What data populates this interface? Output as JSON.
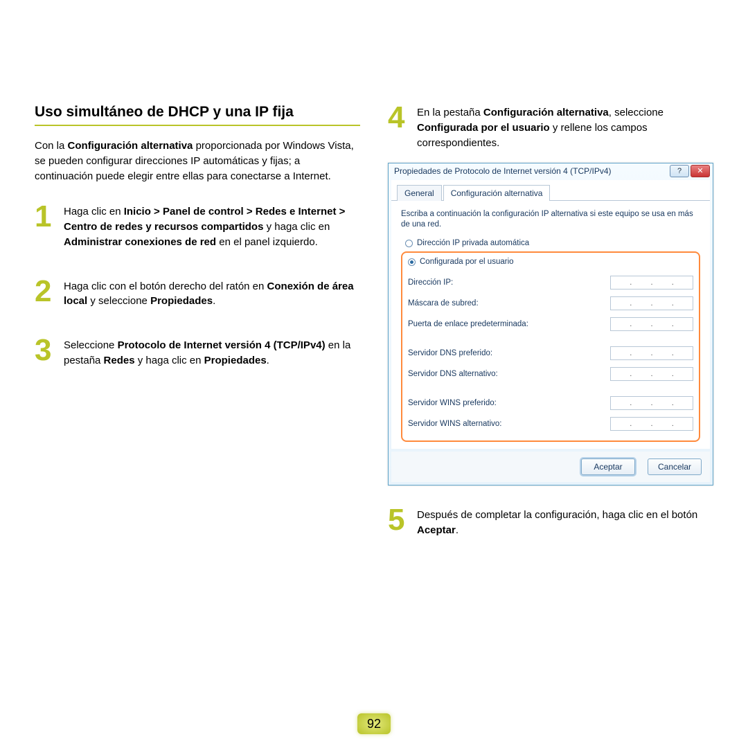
{
  "page_number": "92",
  "heading": "Uso simultáneo de DHCP y una IP fija",
  "intro": {
    "pre": "Con la ",
    "b1": "Configuración alternativa",
    "post": " proporcionada por Windows Vista, se pueden configurar direcciones IP automáticas y fijas; a continuación puede elegir entre ellas para conectarse a Internet."
  },
  "steps": {
    "s1": {
      "num": "1",
      "t1": "Haga clic en ",
      "b1": "Inicio > Panel de control > Redes e Internet > Centro de redes y recursos compartidos",
      "t2": " y haga clic en ",
      "b2": "Administrar conexiones de red",
      "t3": " en el panel izquierdo."
    },
    "s2": {
      "num": "2",
      "t1": "Haga clic con el botón derecho del ratón en ",
      "b1": "Conexión de área local",
      "t2": " y seleccione ",
      "b2": "Propiedades",
      "t3": "."
    },
    "s3": {
      "num": "3",
      "t1": "Seleccione ",
      "b1": "Protocolo de Internet versión 4 (TCP/IPv4)",
      "t2": " en la pestaña ",
      "b2": "Redes",
      "t3": " y haga clic en ",
      "b3": "Propiedades",
      "t4": "."
    },
    "s4": {
      "num": "4",
      "t1": "En la pestaña ",
      "b1": "Configuración alternativa",
      "t2": ", seleccione ",
      "b2": "Configurada por el usuario",
      "t3": " y rellene los campos correspondientes."
    },
    "s5": {
      "num": "5",
      "t1": "Después de completar la configuración, haga clic en el botón ",
      "b1": "Aceptar",
      "t2": "."
    }
  },
  "dialog": {
    "title": "Propiedades de Protocolo de Internet versión 4 (TCP/IPv4)",
    "help_glyph": "?",
    "close_glyph": "✕",
    "tabs": {
      "general": "General",
      "alt": "Configuración alternativa"
    },
    "body_text": "Escriba a continuación la configuración IP alternativa si este equipo se usa en más de una red.",
    "radio_auto": "Dirección IP privada automática",
    "radio_user": "Configurada por el usuario",
    "labels": {
      "ip": "Dirección IP:",
      "mask": "Máscara de subred:",
      "gw": "Puerta de enlace predeterminada:",
      "dns1": "Servidor DNS preferido:",
      "dns2": "Servidor DNS alternativo:",
      "wins1": "Servidor WINS preferido:",
      "wins2": "Servidor WINS alternativo:"
    },
    "buttons": {
      "ok": "Aceptar",
      "cancel": "Cancelar"
    }
  }
}
